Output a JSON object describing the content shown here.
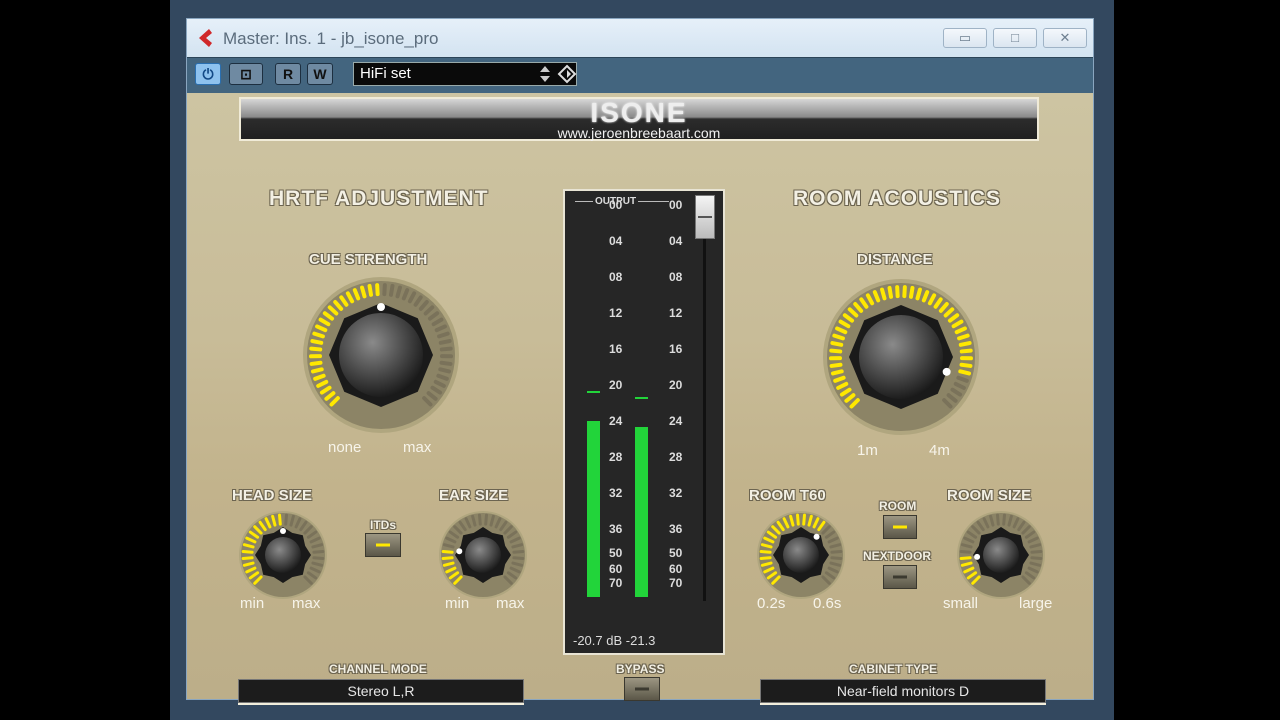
{
  "window": {
    "title": "Master: Ins. 1 - jb_isone_pro",
    "min_glyph": "▭",
    "max_glyph": "□",
    "close_glyph": "✕"
  },
  "toolbar": {
    "power_glyph": "⏻",
    "compare_glyph": "⊡",
    "read_label": "R",
    "write_label": "W",
    "preset_name": "HiFi set"
  },
  "plugin": {
    "name": "ISONE",
    "url": "www.jeroenbreebaart.com",
    "hrtf": {
      "title": "HRTF  ADJUSTMENT",
      "cue_strength": {
        "label": "CUE  STRENGTH",
        "min": "none",
        "max": "max",
        "value": 0.5
      },
      "head_size": {
        "label": "HEAD  SIZE",
        "min": "min",
        "max": "max",
        "value": 0.5
      },
      "itds": {
        "label": "ITDs",
        "on": true
      },
      "ear_size": {
        "label": "EAR  SIZE",
        "min": "min",
        "max": "max",
        "value": 0.2
      }
    },
    "room": {
      "title": "ROOM  ACOUSTICS",
      "distance": {
        "label": "DISTANCE",
        "min": "1m",
        "max": "4m",
        "value": 0.9
      },
      "room_t60": {
        "label": "ROOM  T60",
        "min": "0.2s",
        "max": "0.6s",
        "value": 0.65
      },
      "room_button": {
        "label": "ROOM",
        "on": true
      },
      "nextdoor_button": {
        "label": "NEXTDOOR",
        "on": false
      },
      "room_size": {
        "label": "ROOM  SIZE",
        "min": "small",
        "max": "large",
        "value": 0.15
      }
    },
    "output": {
      "label": "OUTPUT",
      "scale": [
        "00",
        "04",
        "08",
        "12",
        "16",
        "20",
        "24",
        "28",
        "32",
        "36",
        "50",
        "60",
        "70"
      ],
      "left_level_db": -20.7,
      "right_level_db": -21.3,
      "readout_left": "-20.7 dB",
      "readout_right": "-21.3",
      "fader_db": 0
    },
    "channel_mode": {
      "label": "CHANNEL  MODE",
      "value": "Stereo L,R"
    },
    "bypass": {
      "label": "BYPASS",
      "on": false
    },
    "cabinet_type": {
      "label": "CABINET  TYPE",
      "value": "Near-field monitors D"
    }
  },
  "colors": {
    "led_on": "#ffe800",
    "led_off": "#3c3a30",
    "meter_green": "#22d43a",
    "accent_red": "#d0282a"
  }
}
